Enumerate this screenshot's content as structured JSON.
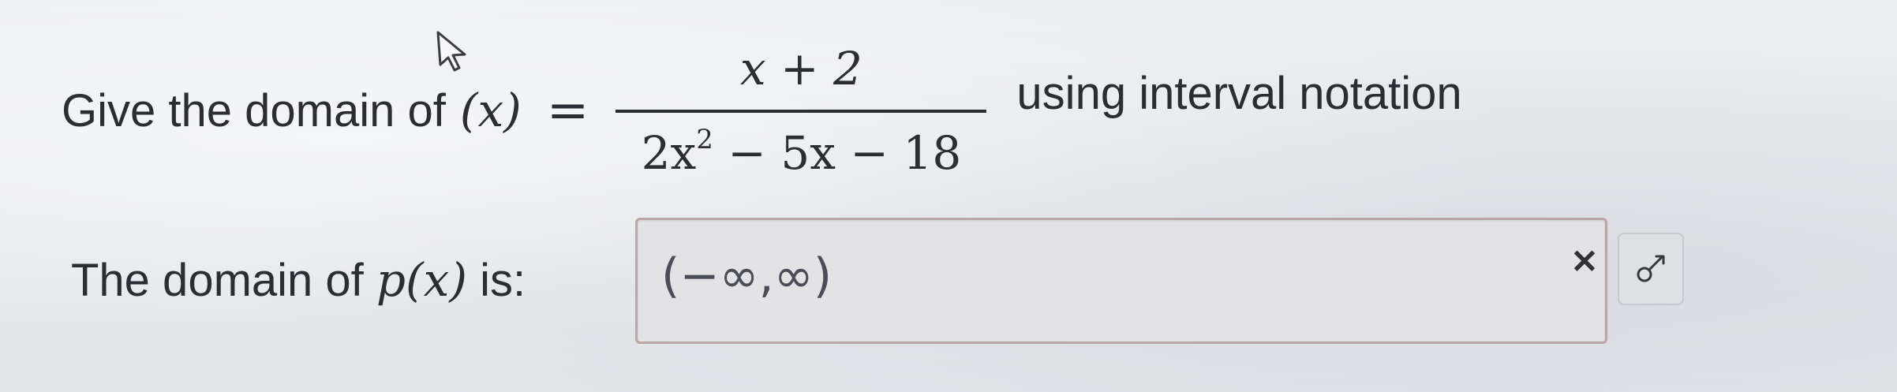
{
  "question": {
    "text": "Give the domain of",
    "function_expr": "(x)",
    "equals": "=",
    "numerator": "x + 2",
    "denominator_prefix": "2x",
    "exponent": "2",
    "denominator_suffix": " − 5x − 18",
    "suffix": "using interval notation"
  },
  "answer": {
    "label_prefix": "The domain of",
    "label_math": "p(x)",
    "label_suffix": "is:",
    "value": "(−∞,∞)"
  },
  "controls": {
    "clear_glyph": "✕",
    "tool_icon": "pencil-icon"
  },
  "colors": {
    "text": "#2b2d33",
    "input_border": "#b7a7a7"
  }
}
